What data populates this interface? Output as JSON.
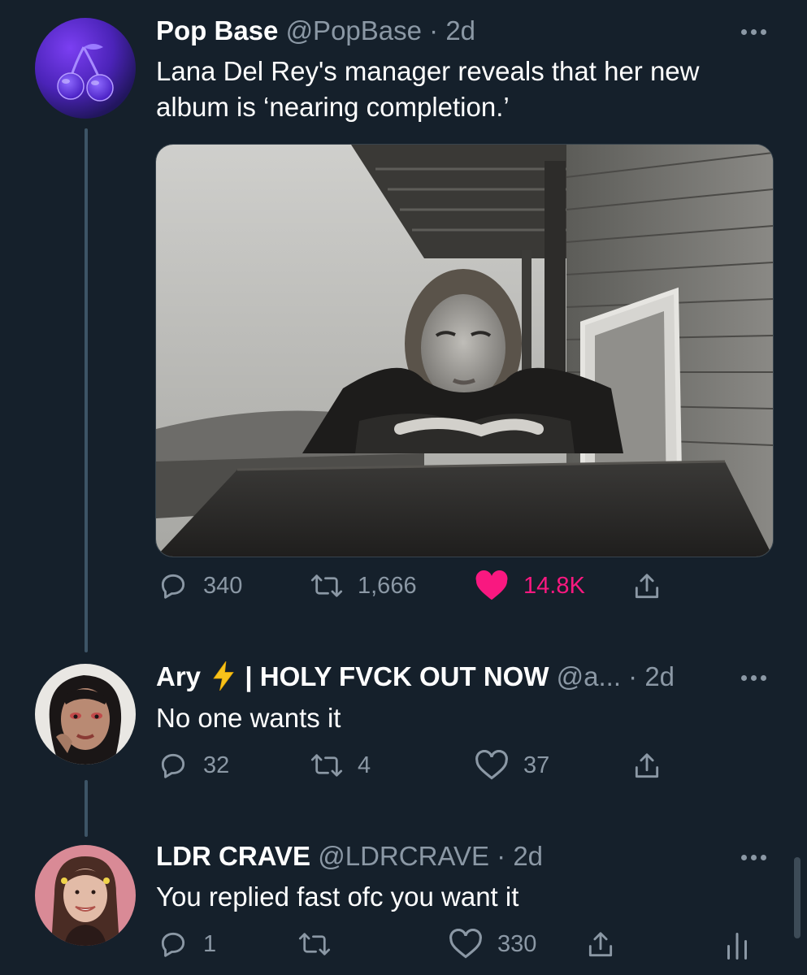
{
  "tweets": [
    {
      "name": "Pop Base",
      "handle": "@PopBase",
      "time": "· 2d",
      "text_line1": "Lana Del Rey's manager reveals that her new",
      "text_line2": "album is ‘nearing completion.’",
      "replies": "340",
      "retweets": "1,666",
      "likes": "14.8K",
      "liked": true
    },
    {
      "name_part1": "Ary",
      "name_part2": "| HOLY FVCK OUT NOW",
      "handle": "@a...",
      "time": "· 2d",
      "text": "No one wants it",
      "replies": "32",
      "retweets": "4",
      "likes": "37",
      "liked": false
    },
    {
      "name": "LDR CRAVE",
      "handle": "@LDRCRAVE",
      "time": "· 2d",
      "text": "You replied fast ofc you want it",
      "replies": "1",
      "retweets": "",
      "likes": "330",
      "liked": false
    }
  ],
  "colors": {
    "background": "#15202b",
    "muted": "#8b98a5",
    "like_active": "#f91880",
    "thread_line": "#3d5466"
  },
  "icons": [
    "reply-icon",
    "retweet-icon",
    "like-icon",
    "share-icon",
    "more-icon",
    "lightning-icon",
    "analytics-icon",
    "cherries-logo"
  ]
}
